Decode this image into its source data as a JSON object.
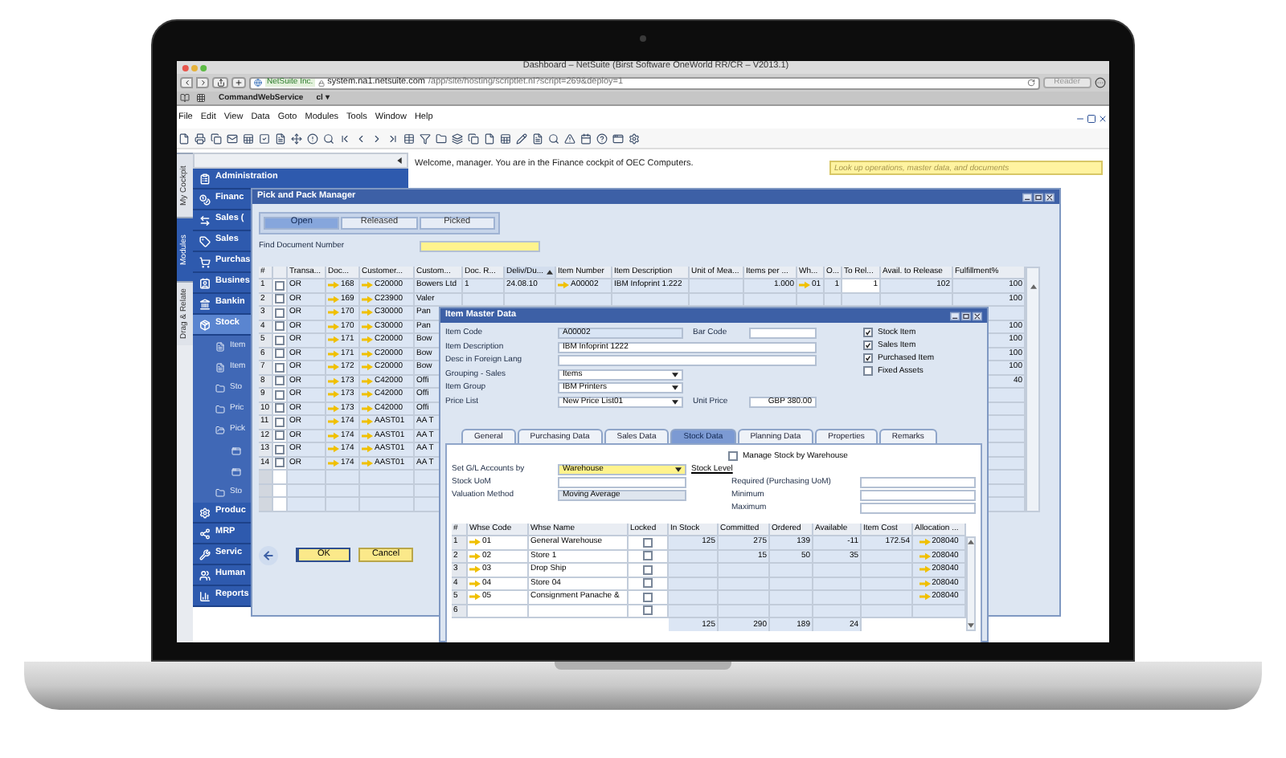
{
  "browser": {
    "title": "Dashboard – NetSuite (Birst Software OneWorld RR/CR – V2013.1)",
    "site_badge": "NetSuite Inc.",
    "url_host": "system.na1.netsuite.com",
    "url_path": "/app/site/hosting/scriptlet.nl?script=269&deploy=1",
    "reader_button": "Reader",
    "bookmarks": [
      "CommandWebService",
      "cl ▾"
    ]
  },
  "menu": [
    "File",
    "Edit",
    "View",
    "Data",
    "Goto",
    "Modules",
    "Tools",
    "Window",
    "Help"
  ],
  "vertical_tabs": [
    {
      "label": "My Cockpit",
      "selected": false
    },
    {
      "label": "Modules",
      "selected": true
    },
    {
      "label": "Drag & Relate",
      "selected": false
    }
  ],
  "nav": {
    "items": [
      {
        "label": "Administration",
        "expanded": false
      },
      {
        "label": "Financ",
        "expanded": false
      },
      {
        "label": "Sales (",
        "expanded": false
      },
      {
        "label": "Sales",
        "expanded": false
      },
      {
        "label": "Purchas",
        "expanded": false
      },
      {
        "label": "Busines",
        "expanded": false
      },
      {
        "label": "Bankin",
        "expanded": false
      },
      {
        "label": "Stock",
        "expanded": true,
        "children": [
          {
            "kind": "form",
            "label": "Item"
          },
          {
            "kind": "form",
            "label": "Item"
          },
          {
            "kind": "folder",
            "label": "Sto",
            "expanded": false
          },
          {
            "kind": "folder",
            "label": "Pric",
            "expanded": false
          },
          {
            "kind": "folder",
            "label": "Pick",
            "expanded": true,
            "children": [
              {
                "kind": "window"
              },
              {
                "kind": "window"
              }
            ]
          },
          {
            "kind": "folder",
            "label": "Sto",
            "expanded": false
          }
        ]
      },
      {
        "label": "Produc",
        "expanded": false
      },
      {
        "label": "MRP",
        "expanded": false
      },
      {
        "label": "Servic",
        "expanded": false
      },
      {
        "label": "Human",
        "expanded": false
      },
      {
        "label": "Reports",
        "expanded": false
      }
    ]
  },
  "welcome": "Welcome, manager. You are in the Finance cockpit of OEC Computers.",
  "search": {
    "placeholder": "Look up operations, master data, and documents"
  },
  "pick_pack": {
    "title": "Pick and Pack Manager",
    "tabs": [
      {
        "label": "Open",
        "selected": true
      },
      {
        "label": "Released",
        "selected": false
      },
      {
        "label": "Picked",
        "selected": false
      }
    ],
    "find_label": "Find Document Number",
    "columns": [
      {
        "label": "#",
        "sorted": false
      },
      {
        "label": "Transa...",
        "sorted": false
      },
      {
        "label": "Doc...",
        "sorted": false
      },
      {
        "label": "Customer...",
        "sorted": false
      },
      {
        "label": "Custom...",
        "sorted": false
      },
      {
        "label": "Doc. R...",
        "sorted": false
      },
      {
        "label": "Deliv/Du...",
        "sorted": true
      },
      {
        "label": "Item Number",
        "sorted": false
      },
      {
        "label": "Item Description",
        "sorted": false
      },
      {
        "label": "Unit of Mea...",
        "sorted": false
      },
      {
        "label": "Items per ...",
        "sorted": false
      },
      {
        "label": "Wh...",
        "sorted": false
      },
      {
        "label": "O...",
        "sorted": false
      },
      {
        "label": "To Rel...",
        "sorted": false
      },
      {
        "label": "Avail. to Release",
        "sorted": false
      },
      {
        "label": "Fulfillment%",
        "sorted": false
      }
    ],
    "rows": [
      {
        "number": "1",
        "checked": false,
        "transaction": "OR",
        "doc": "168",
        "customer_code": "C20000",
        "customer_name": "Bowers Ltd",
        "doc_ref": "1",
        "delivery_date": "24.08.10",
        "item_number": "A00002",
        "item_description": "IBM Infoprint 1.222",
        "items_per_unit": "1.000",
        "warehouse": "01",
        "open": "1",
        "to_release": "1",
        "available": "102",
        "fulfillment": "100"
      },
      {
        "number": "2",
        "checked": false,
        "transaction": "OR",
        "doc": "169",
        "customer_code": "C23900",
        "customer_name": "Valer",
        "fulfillment": "100"
      },
      {
        "number": "3",
        "checked": false,
        "transaction": "OR",
        "doc": "170",
        "customer_code": "C30000",
        "customer_name": "Pan"
      },
      {
        "number": "4",
        "checked": false,
        "transaction": "OR",
        "doc": "170",
        "customer_code": "C30000",
        "customer_name": "Pan",
        "fulfillment": "100"
      },
      {
        "number": "5",
        "checked": false,
        "transaction": "OR",
        "doc": "171",
        "customer_code": "C20000",
        "customer_name": "Bow",
        "fulfillment": "100"
      },
      {
        "number": "6",
        "checked": false,
        "transaction": "OR",
        "doc": "171",
        "customer_code": "C20000",
        "customer_name": "Bow",
        "fulfillment": "100"
      },
      {
        "number": "7",
        "checked": false,
        "transaction": "OR",
        "doc": "172",
        "customer_code": "C20000",
        "customer_name": "Bow",
        "fulfillment": "100"
      },
      {
        "number": "8",
        "checked": false,
        "transaction": "OR",
        "doc": "173",
        "customer_code": "C42000",
        "customer_name": "Offi",
        "fulfillment": "40"
      },
      {
        "number": "9",
        "checked": false,
        "transaction": "OR",
        "doc": "173",
        "customer_code": "C42000",
        "customer_name": "Offi"
      },
      {
        "number": "10",
        "checked": false,
        "transaction": "OR",
        "doc": "173",
        "customer_code": "C42000",
        "customer_name": "Offi"
      },
      {
        "number": "11",
        "checked": false,
        "transaction": "OR",
        "doc": "174",
        "customer_code": "AAST01",
        "customer_name": "AA T"
      },
      {
        "number": "12",
        "checked": false,
        "transaction": "OR",
        "doc": "174",
        "customer_code": "AAST01",
        "customer_name": "AA T"
      },
      {
        "number": "13",
        "checked": false,
        "transaction": "OR",
        "doc": "174",
        "customer_code": "AAST01",
        "customer_name": "AA T"
      },
      {
        "number": "14",
        "checked": false,
        "transaction": "OR",
        "doc": "174",
        "customer_code": "AAST01",
        "customer_name": "AA T"
      }
    ],
    "buttons": [
      {
        "label": "OK",
        "focused": true
      },
      {
        "label": "Cancel",
        "focused": false
      }
    ]
  },
  "item_master": {
    "title": "Item Master Data",
    "item_code": {
      "label": "Item Code",
      "value": "A00002"
    },
    "bar_code": {
      "label": "Bar Code"
    },
    "item_description": {
      "label": "Item Description",
      "value": "IBM Infoprint 1222"
    },
    "foreign_description": {
      "label": "Desc in Foreign Lang"
    },
    "grouping": {
      "label": "Grouping - Sales",
      "value": "Items"
    },
    "item_group": {
      "label": "Item Group",
      "value": "IBM Printers"
    },
    "price_list": {
      "label": "Price List",
      "value": "New Price List01"
    },
    "unit_price": {
      "label": "Unit Price",
      "value": "GBP 380.00"
    },
    "flags": [
      {
        "label": "Stock Item",
        "checked": true
      },
      {
        "label": "Sales Item",
        "checked": true
      },
      {
        "label": "Purchased Item",
        "checked": true
      },
      {
        "label": "Fixed Assets",
        "checked": false
      }
    ],
    "tabs": [
      {
        "label": "General",
        "selected": false
      },
      {
        "label": "Purchasing Data",
        "selected": false
      },
      {
        "label": "Sales Data",
        "selected": false
      },
      {
        "label": "Stock Data",
        "selected": true
      },
      {
        "label": "Planning Data",
        "selected": false
      },
      {
        "label": "Properties",
        "selected": false
      },
      {
        "label": "Remarks",
        "selected": false
      }
    ],
    "manage_by_warehouse": {
      "label": "Manage Stock by Warehouse",
      "checked": false
    },
    "gl_accounts": {
      "label": "Set G/L Accounts by",
      "value": "Warehouse"
    },
    "stock_uom": {
      "label": "Stock UoM"
    },
    "valuation": {
      "label": "Valuation Method",
      "value": "Moving Average"
    },
    "stock_level": "Stock Level",
    "required": {
      "label": "Required (Purchasing UoM)"
    },
    "minimum": {
      "label": "Minimum"
    },
    "maximum": {
      "label": "Maximum"
    },
    "columns": [
      "#",
      "Whse Code",
      "Whse Name",
      "Locked",
      "In Stock",
      "Committed",
      "Ordered",
      "Available",
      "Item Cost",
      "Allocation ..."
    ],
    "rows": [
      {
        "number": "1",
        "code": "01",
        "name": "General Warehouse",
        "locked": false,
        "in_stock": "125",
        "committed": "275",
        "ordered": "139",
        "available": "-11",
        "item_cost": "172.54",
        "allocation": "208040"
      },
      {
        "number": "2",
        "code": "02",
        "name": "Store 1",
        "locked": false,
        "committed": "15",
        "ordered": "50",
        "available": "35",
        "allocation": "208040"
      },
      {
        "number": "3",
        "code": "03",
        "name": "Drop Ship",
        "locked": false,
        "allocation": "208040"
      },
      {
        "number": "4",
        "code": "04",
        "name": "Store 04",
        "locked": false,
        "allocation": "208040"
      },
      {
        "number": "5",
        "code": "05",
        "name": "Consignment Panache &",
        "locked": false,
        "allocation": "208040"
      },
      {
        "number": "6",
        "locked": false
      }
    ],
    "totals": {
      "in_stock": "125",
      "committed": "290",
      "ordered": "189",
      "available": "24"
    }
  }
}
